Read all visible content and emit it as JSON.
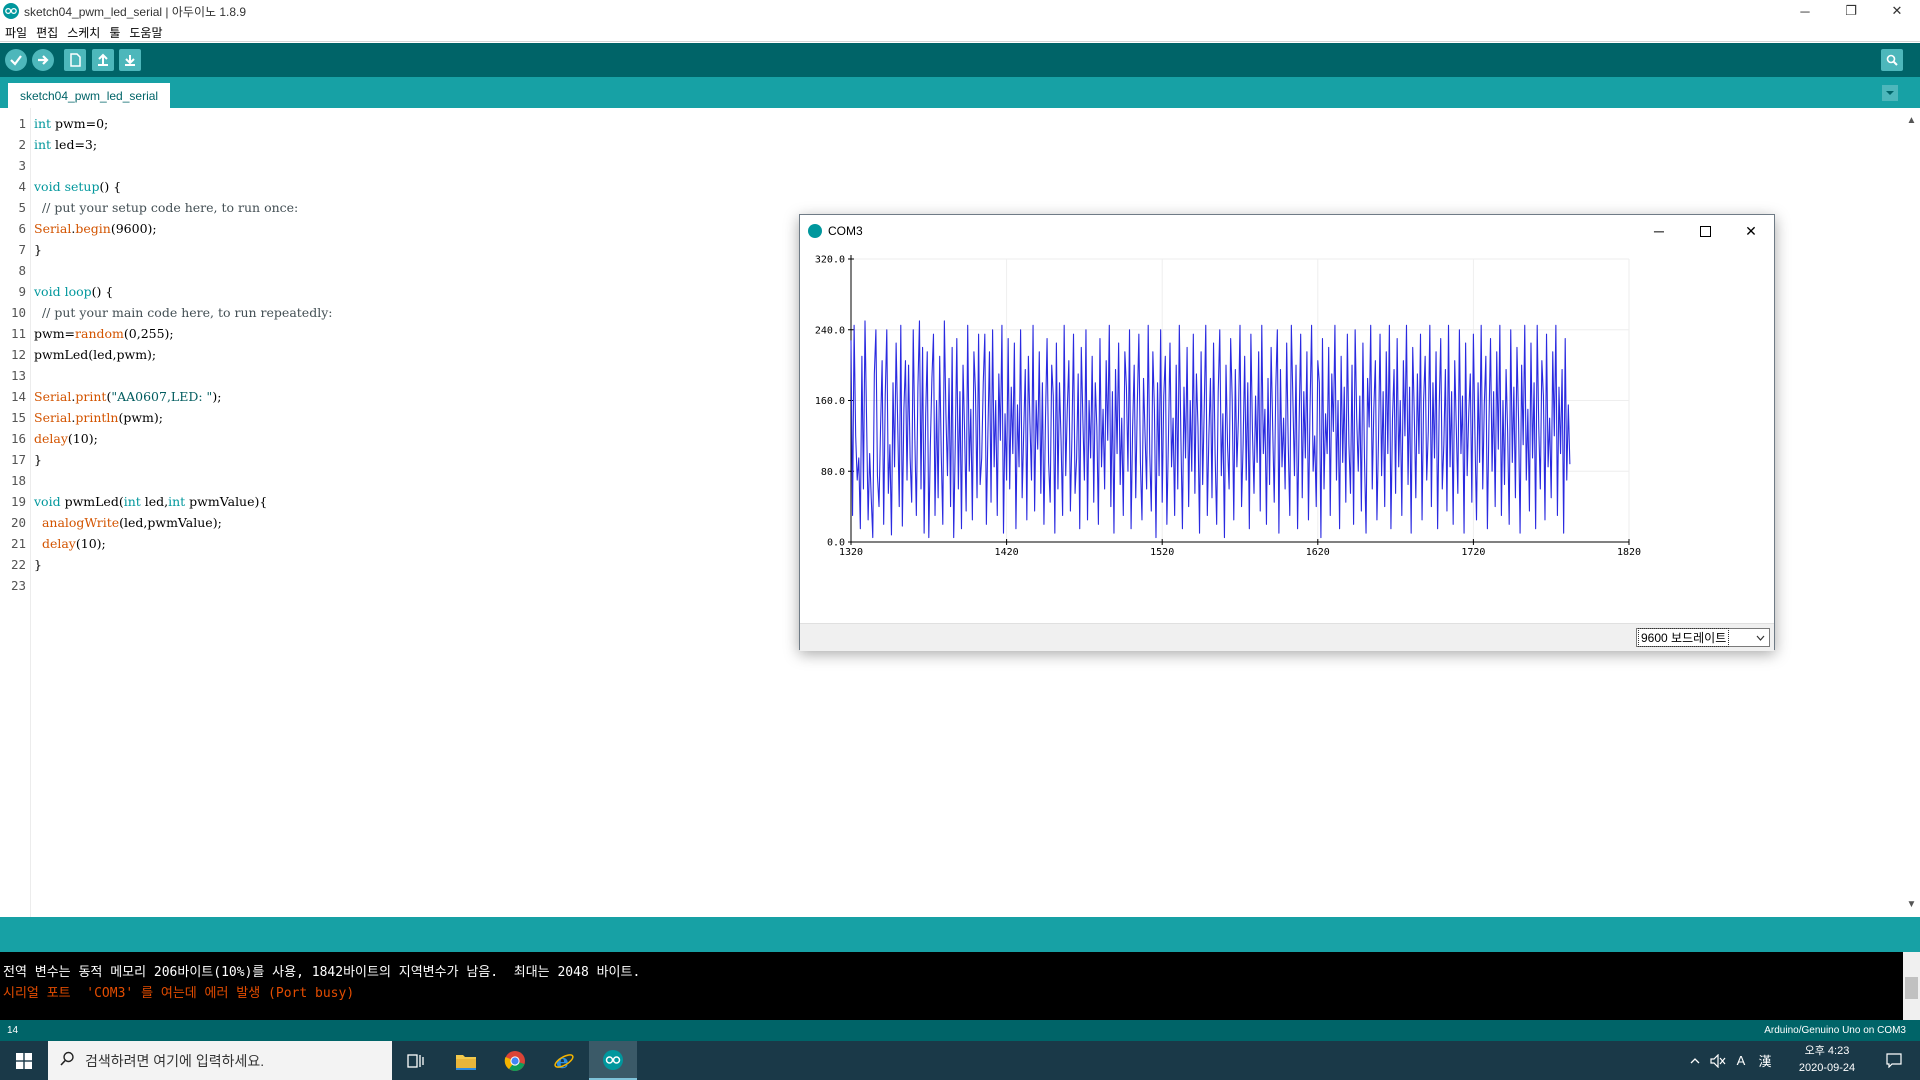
{
  "window": {
    "title": "sketch04_pwm_led_serial | 아두이노 1.8.9",
    "minimize": "─",
    "maximize": "❐",
    "close": "✕"
  },
  "menu": [
    "파일",
    "편집",
    "스케치",
    "툴",
    "도움말"
  ],
  "toolbar": {
    "icons": [
      "verify-icon",
      "upload-icon",
      "new-icon",
      "open-icon",
      "save-icon",
      "serial-monitor-icon"
    ]
  },
  "tab": {
    "label": "sketch04_pwm_led_serial"
  },
  "code": {
    "line_numbers": [
      "1",
      "2",
      "3",
      "4",
      "5",
      "6",
      "7",
      "8",
      "9",
      "10",
      "11",
      "12",
      "13",
      "14",
      "15",
      "16",
      "17",
      "18",
      "19",
      "20",
      "21",
      "22",
      "23"
    ],
    "lines": [
      [
        {
          "t": "int",
          "c": "kw"
        },
        {
          "t": " pwm=0;"
        }
      ],
      [
        {
          "t": "int",
          "c": "kw"
        },
        {
          "t": " led=3;"
        }
      ],
      [],
      [
        {
          "t": "void",
          "c": "kw"
        },
        {
          "t": " "
        },
        {
          "t": "setup",
          "c": "kw"
        },
        {
          "t": "() {"
        }
      ],
      [
        {
          "t": "  // put your setup code here, to run once:",
          "c": "cm"
        }
      ],
      [
        {
          "t": "Serial",
          "c": "fn"
        },
        {
          "t": "."
        },
        {
          "t": "begin",
          "c": "fn"
        },
        {
          "t": "(9600);"
        }
      ],
      [
        {
          "t": "}"
        }
      ],
      [],
      [
        {
          "t": "void",
          "c": "kw"
        },
        {
          "t": " "
        },
        {
          "t": "loop",
          "c": "kw"
        },
        {
          "t": "() {"
        }
      ],
      [
        {
          "t": "  // put your main code here, to run repeatedly:",
          "c": "cm"
        }
      ],
      [
        {
          "t": "pwm="
        },
        {
          "t": "random",
          "c": "fn"
        },
        {
          "t": "(0,255);"
        }
      ],
      [
        {
          "t": "pwmLed(led,pwm);"
        }
      ],
      [],
      [
        {
          "t": "Serial",
          "c": "fn"
        },
        {
          "t": "."
        },
        {
          "t": "print",
          "c": "fn"
        },
        {
          "t": "("
        },
        {
          "t": "\"AA0607,LED: \"",
          "c": "str"
        },
        {
          "t": ");"
        }
      ],
      [
        {
          "t": "Serial",
          "c": "fn"
        },
        {
          "t": "."
        },
        {
          "t": "println",
          "c": "fn"
        },
        {
          "t": "(pwm);"
        }
      ],
      [
        {
          "t": "delay",
          "c": "fn"
        },
        {
          "t": "(10);"
        }
      ],
      [
        {
          "t": "}"
        }
      ],
      [],
      [
        {
          "t": "void",
          "c": "kw"
        },
        {
          "t": " pwmLed("
        },
        {
          "t": "int",
          "c": "kw"
        },
        {
          "t": " led,"
        },
        {
          "t": "int",
          "c": "kw"
        },
        {
          "t": " pwmValue){"
        }
      ],
      [
        {
          "t": "  "
        },
        {
          "t": "analogWrite",
          "c": "fn"
        },
        {
          "t": "(led,pwmValue);"
        }
      ],
      [
        {
          "t": "  "
        },
        {
          "t": "delay",
          "c": "fn"
        },
        {
          "t": "(10);"
        }
      ],
      [
        {
          "t": "}"
        }
      ],
      []
    ]
  },
  "console": {
    "line1": "전역 변수는 동적 메모리 206바이트(10%)를 사용, 1842바이트의 지역변수가 남음.  최대는 2048 바이트.",
    "line2": "시리얼 포트  'COM3' 를 여는데 에러 발생 (Port busy)",
    "line1_color": "#ffffff",
    "line2_color": "#e34c00"
  },
  "status": {
    "line": "14",
    "board": "Arduino/Genuino Uno on COM3"
  },
  "plotter": {
    "title": "COM3",
    "baud": "9600 보드레이트",
    "chart_data": {
      "type": "line",
      "x_ticks": [
        "1320",
        "1420",
        "1520",
        "1620",
        "1720",
        "1820"
      ],
      "y_ticks": [
        "0.0",
        "80.0",
        "160.0",
        "240.0",
        "320.0"
      ],
      "xlim": [
        1320,
        1820
      ],
      "ylim": [
        0,
        320
      ],
      "grid": true,
      "line_color": "#2a2ae0",
      "series": [
        {
          "x_start": 1320,
          "x_step": 1,
          "values": [
            228,
            30,
            245,
            120,
            70,
            95,
            15,
            210,
            60,
            250,
            140,
            25,
            100,
            50,
            5,
            190,
            240,
            75,
            40,
            130,
            205,
            20,
            165,
            240,
            55,
            110,
            8,
            180,
            85,
            225,
            135,
            40,
            245,
            18,
            150,
            205,
            70,
            200,
            95,
            45,
            240,
            120,
            30,
            175,
            250,
            60,
            220,
            10,
            145,
            215,
            5,
            110,
            185,
            235,
            30,
            160,
            50,
            210,
            100,
            20,
            250,
            145,
            75,
            185,
            40,
            220,
            5,
            110,
            230,
            60,
            170,
            15,
            200,
            125,
            35,
            245,
            80,
            150,
            25,
            215,
            170,
            50,
            235,
            65,
            95,
            180,
            235,
            20,
            125,
            215,
            45,
            240,
            85,
            160,
            30,
            190,
            115,
            245,
            10,
            145,
            70,
            230,
            60,
            175,
            100,
            225,
            15,
            155,
            85,
            240,
            50,
            125,
            195,
            25,
            210,
            135,
            70,
            245,
            35,
            160,
            105,
            215,
            55,
            180,
            20,
            140,
            230,
            90,
            45,
            200,
            165,
            10,
            225,
            60,
            180,
            115,
            30,
            245,
            75,
            150,
            205,
            35,
            120,
            235,
            55,
            95,
            190,
            15,
            220,
            140,
            70,
            240,
            25,
            160,
            95,
            210,
            45,
            180,
            130,
            20,
            230,
            85,
            150,
            60,
            205,
            115,
            245,
            40,
            170,
            10,
            195,
            100,
            225,
            65,
            140,
            30,
            215,
            175,
            80,
            240,
            15,
            130,
            200,
            50,
            155,
            235,
            90,
            25,
            185,
            120,
            60,
            245,
            100,
            35,
            215,
            150,
            5,
            180,
            75,
            240,
            45,
            165,
            210,
            20,
            115,
            225,
            85,
            140,
            30,
            200,
            60,
            245,
            120,
            15,
            175,
            95,
            220,
            40,
            160,
            80,
            235,
            55,
            190,
            130,
            10,
            215,
            65,
            150,
            245,
            30,
            120,
            185,
            50,
            225,
            100,
            20,
            170,
            240,
            75,
            145,
            5,
            200,
            110,
            60,
            230,
            160,
            25,
            195,
            85,
            140,
            245,
            40,
            110,
            210,
            70,
            180,
            15,
            235,
            125,
            55,
            165,
            90,
            215,
            35,
            245,
            100,
            150,
            20,
            185,
            65,
            220,
            130,
            45,
            175,
            240,
            10,
            195,
            85,
            140,
            60,
            225,
            110,
            30,
            245,
            160,
            75,
            200,
            15,
            135,
            235,
            50,
            170,
            95,
            215,
            25,
            150,
            245,
            80,
            120,
            40,
            205,
            180,
            5,
            230,
            60,
            145,
            100,
            220,
            30,
            190,
            125,
            245,
            70,
            160,
            15,
            210,
            90,
            175,
            45,
            235,
            110,
            55,
            200,
            20,
            240,
            140,
            80,
            165,
            35,
            225,
            95,
            10,
            185,
            130,
            245,
            60,
            150,
            205,
            25,
            115,
            235,
            75,
            170,
            40,
            215,
            100,
            245,
            15,
            140,
            195,
            55,
            230,
            85,
            160,
            30,
            205,
            120,
            245,
            65,
            175,
            10,
            220,
            145,
            50,
            190,
            100,
            235,
            25,
            160,
            210,
            70,
            125,
            245,
            40,
            180,
            95,
            215,
            15,
            150,
            230,
            60,
            110,
            195,
            35,
            245,
            85,
            170,
            20,
            205,
            130,
            55,
            240,
            100,
            165,
            10,
            225,
            75,
            145,
            190,
            45,
            235,
            120,
            25,
            180,
            90,
            245,
            60,
            155,
            210,
            15,
            135,
            230,
            80,
            170,
            40,
            215,
            105,
            245,
            30,
            160,
            65,
            195,
            125,
            20,
            240,
            90,
            175,
            50,
            220,
            140,
            10,
            200,
            110,
            245,
            70,
            150,
            35,
            225,
            95,
            180,
            15,
            245,
            130,
            60,
            205,
            165,
            25,
            235,
            85,
            140,
            50,
            215,
            120,
            245,
            30,
            175,
            100,
            195,
            10,
            230,
            70,
            155,
            88
          ]
        }
      ]
    }
  },
  "taskbar": {
    "search_placeholder": "검색하려면 여기에 입력하세요.",
    "clock_time": "오후 4:23",
    "clock_date": "2020-09-24",
    "ime": "A",
    "ime2": "漢"
  }
}
